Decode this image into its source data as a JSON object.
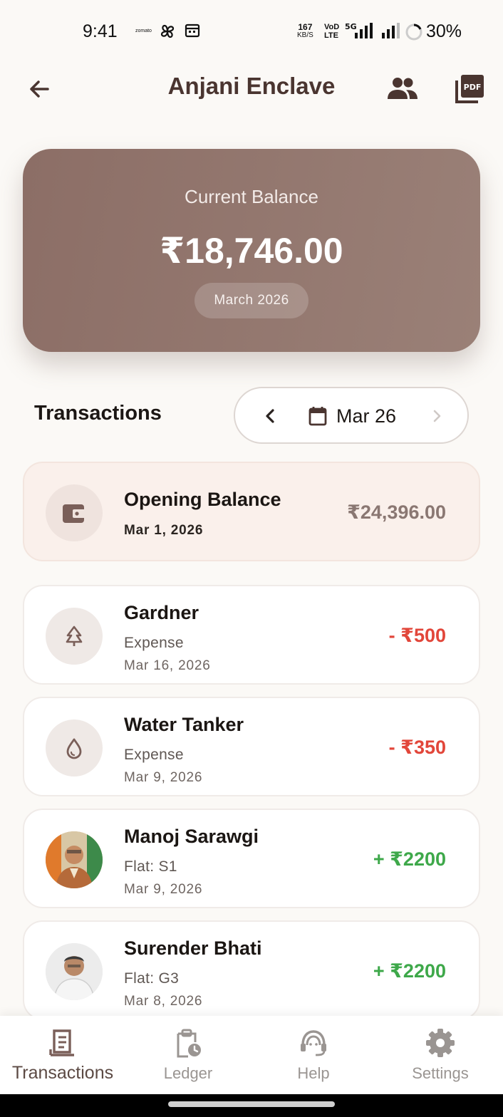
{
  "status_bar": {
    "time": "9:41",
    "app_badge": "zomato",
    "net_speed_value": "167",
    "net_speed_unit": "KB/S",
    "volte_top": "VoD",
    "volte_bottom": "LTE",
    "network_type": "5G",
    "battery": "30%"
  },
  "header": {
    "title": "Anjani Enclave",
    "back_icon": "arrow-left",
    "members_icon": "group",
    "pdf_icon": "pdf"
  },
  "balance_card": {
    "label": "Current Balance",
    "amount": "₹18,746.00",
    "month": "March 2026"
  },
  "transactions": {
    "heading": "Transactions",
    "month_picker": {
      "label": "Mar 26"
    },
    "items": [
      {
        "title": "Opening Balance",
        "subtitle": "",
        "date": "Mar 1, 2026",
        "amount": "₹24,396.00",
        "kind": "opening",
        "icon": "wallet"
      },
      {
        "title": "Gardner",
        "subtitle": "Expense",
        "date": "Mar 16, 2026",
        "amount": "- ₹500",
        "kind": "expense",
        "icon": "tree"
      },
      {
        "title": "Water Tanker",
        "subtitle": "Expense",
        "date": "Mar 9, 2026",
        "amount": "- ₹350",
        "kind": "expense",
        "icon": "water-drop"
      },
      {
        "title": "Manoj Sarawgi",
        "subtitle": "Flat: S1",
        "date": "Mar 9, 2026",
        "amount": "+ ₹2200",
        "kind": "income",
        "icon": "person-photo"
      },
      {
        "title": "Surender Bhati",
        "subtitle": "Flat: G3",
        "date": "Mar 8, 2026",
        "amount": "+ ₹2200",
        "kind": "income",
        "icon": "person-photo"
      }
    ]
  },
  "bottom_nav": {
    "items": [
      {
        "label": "Transactions",
        "icon": "receipt",
        "active": true
      },
      {
        "label": "Ledger",
        "icon": "clipboard-clock",
        "active": false
      },
      {
        "label": "Help",
        "icon": "support-agent",
        "active": false
      },
      {
        "label": "Settings",
        "icon": "gear",
        "active": false
      }
    ]
  },
  "colors": {
    "brand_brown": "#4a3530",
    "card_gradient_start": "#8c6e66",
    "card_gradient_end": "#9a8077",
    "expense_red": "#e2463a",
    "income_green": "#3ea84a"
  }
}
